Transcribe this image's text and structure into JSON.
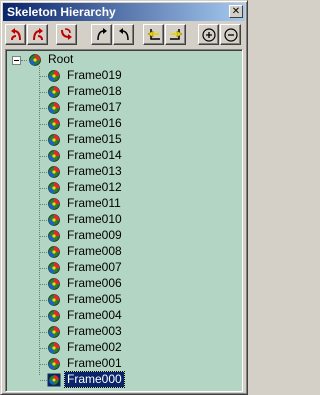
{
  "window": {
    "title": "Skeleton Hierarchy",
    "close_glyph": "✕"
  },
  "toolbar": {
    "buttons": [
      {
        "name": "link-bone-up-button",
        "icon": "red-arrow-up-left-icon"
      },
      {
        "name": "unlink-bone-up-button",
        "icon": "red-arrow-up-right-icon"
      },
      {
        "name": "rotate-bone-button",
        "icon": "red-swap-arrows-icon"
      },
      {
        "name": "move-up-button",
        "icon": "black-arrow-up-right-icon"
      },
      {
        "name": "move-down-button",
        "icon": "black-arrow-up-left-icon"
      },
      {
        "name": "promote-button",
        "icon": "yellow-arrow-left-icon"
      },
      {
        "name": "demote-button",
        "icon": "yellow-arrow-right-icon"
      },
      {
        "name": "expand-all-button",
        "icon": "plus-circle-icon"
      },
      {
        "name": "collapse-all-button",
        "icon": "minus-circle-icon"
      }
    ]
  },
  "tree": {
    "root": {
      "label": "Root",
      "expanded": true
    },
    "children": [
      "Frame019",
      "Frame018",
      "Frame017",
      "Frame016",
      "Frame015",
      "Frame014",
      "Frame013",
      "Frame012",
      "Frame011",
      "Frame010",
      "Frame009",
      "Frame008",
      "Frame007",
      "Frame006",
      "Frame005",
      "Frame004",
      "Frame003",
      "Frame002",
      "Frame001",
      "Frame000"
    ],
    "selected": "Frame000"
  },
  "colors": {
    "tree_background": "#b3d6c4",
    "title_gradient_start": "#0a246a",
    "title_gradient_end": "#a6caf0",
    "selection": "#0a246a"
  }
}
